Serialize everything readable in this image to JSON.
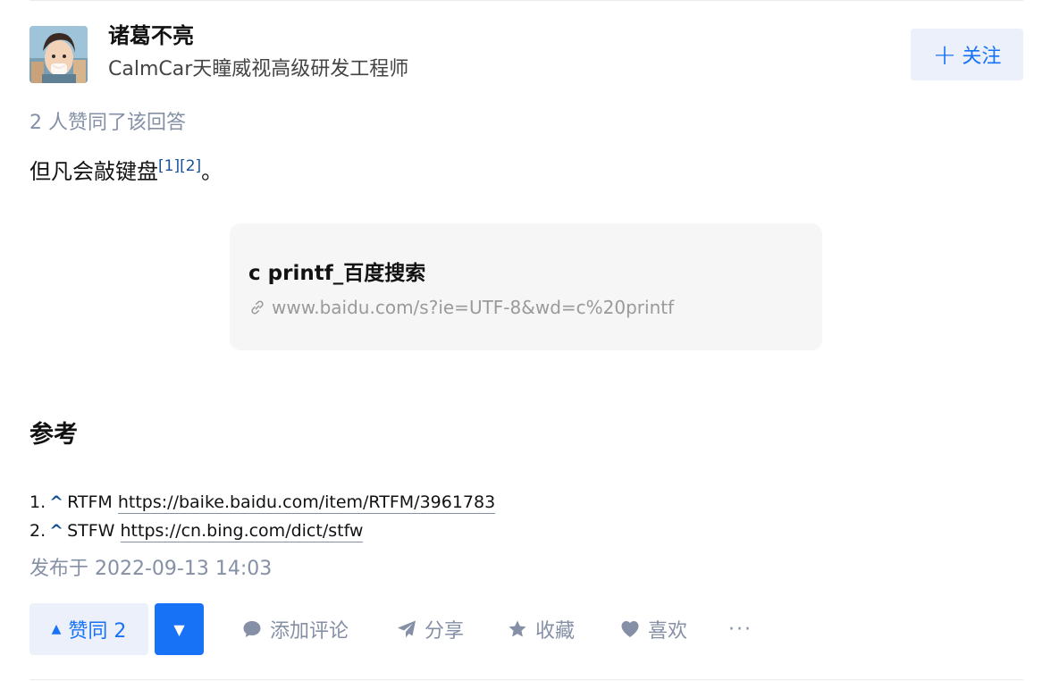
{
  "author": {
    "name": "诸葛不亮",
    "bio": "CalmCar天瞳威视高级研发工程师",
    "follow_label": "关注"
  },
  "vote_summary": "2 人赞同了该回答",
  "answer": {
    "text": "但凡会敲键盘",
    "refs": "[1][2]",
    "end": "。"
  },
  "link_card": {
    "title": "c printf_百度搜索",
    "url": "www.baidu.com/s?ie=UTF-8&wd=c%20printf"
  },
  "references": {
    "title": "参考",
    "items": [
      {
        "num": "1.",
        "caret": "^",
        "label": "RTFM",
        "url": "https://baike.baidu.com/item/RTFM/3961783"
      },
      {
        "num": "2.",
        "caret": "^",
        "label": "STFW",
        "url": "https://cn.bing.com/dict/stfw"
      }
    ]
  },
  "publish_time": "发布于 2022-09-13 14:03",
  "actions": {
    "upvote_label": "赞同 2",
    "comment_label": "添加评论",
    "share_label": "分享",
    "collect_label": "收藏",
    "like_label": "喜欢",
    "more_label": "···"
  },
  "colors": {
    "accent": "#1772f6",
    "accent_bg": "#ebf0fa",
    "muted": "#8590a6",
    "ref_blue": "#175199"
  },
  "icons": {
    "follow": "plus-icon",
    "upvote": "triangle-up-icon",
    "downvote": "triangle-down-icon",
    "comment": "comment-bubble-icon",
    "share": "paper-plane-icon",
    "collect": "star-icon",
    "like": "heart-icon",
    "more": "ellipsis-icon",
    "link": "chain-link-icon"
  }
}
